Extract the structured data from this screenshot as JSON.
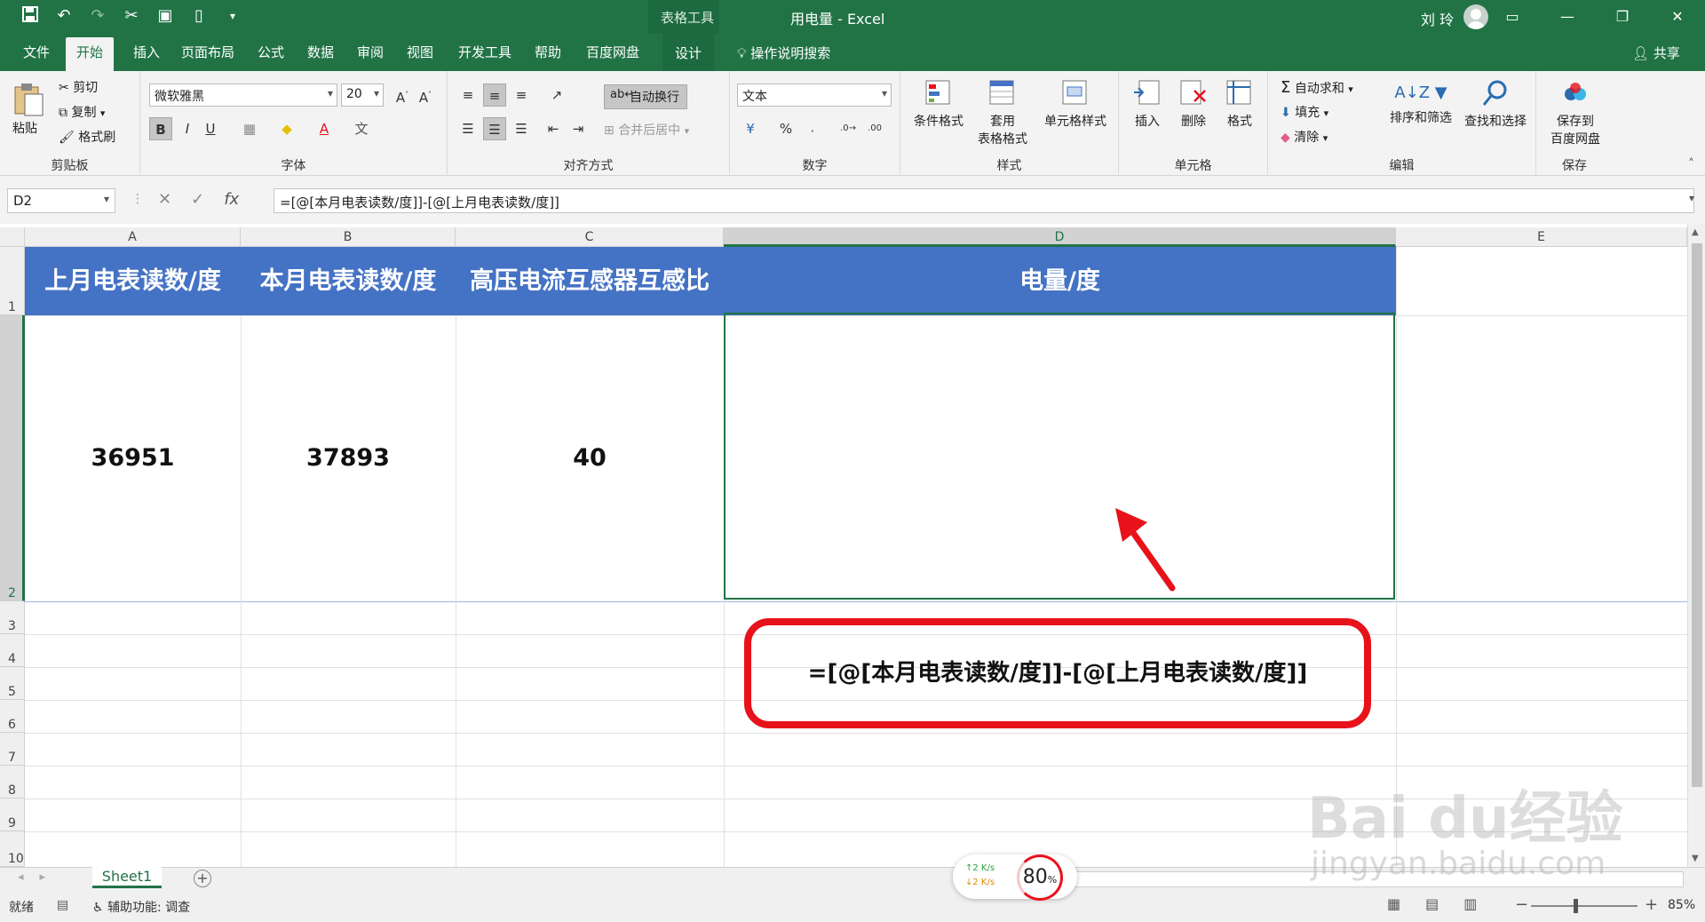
{
  "titlebar": {
    "context_tool": "表格工具",
    "document_title": "用电量 - Excel",
    "user_name": "刘 玲",
    "window_controls": [
      "ribbon-display-icon",
      "minimize-icon",
      "restore-icon",
      "close-icon"
    ]
  },
  "tabs": {
    "items": [
      "文件",
      "开始",
      "插入",
      "页面布局",
      "公式",
      "数据",
      "审阅",
      "视图",
      "开发工具",
      "帮助",
      "百度网盘",
      "设计"
    ],
    "active": "开始",
    "tell_me": "操作说明搜索",
    "share": "共享"
  },
  "ribbon": {
    "clipboard": {
      "paste": "粘贴",
      "cut": "剪切",
      "copy": "复制",
      "format_painter": "格式刷",
      "label": "剪贴板"
    },
    "font": {
      "name": "微软雅黑",
      "size": "20",
      "bold": "B",
      "italic": "I",
      "underline": "U",
      "label": "字体"
    },
    "alignment": {
      "wrap_text": "自动换行",
      "merge_center": "合并后居中",
      "label": "对齐方式"
    },
    "number": {
      "format": "文本",
      "percent": "%",
      "label": "数字"
    },
    "styles": {
      "conditional": "条件格式",
      "table_format_1": "套用",
      "table_format_2": "表格格式",
      "cell_styles": "单元格样式",
      "label": "样式"
    },
    "cells": {
      "insert": "插入",
      "delete": "删除",
      "format": "格式",
      "label": "单元格"
    },
    "editing": {
      "autosum": "自动求和",
      "fill": "填充",
      "clear": "清除",
      "sort_filter": "排序和筛选",
      "find_select": "查找和选择",
      "label": "编辑"
    },
    "save": {
      "save_to_1": "保存到",
      "save_to_2": "百度网盘",
      "label": "保存"
    }
  },
  "formula_bar": {
    "name_box": "D2",
    "cancel": "✕",
    "enter": "✓",
    "fx": "fx",
    "formula": "=[@[本月电表读数/度]]-[@[上月电表读数/度]]"
  },
  "sheet": {
    "columns": [
      "A",
      "B",
      "C",
      "D",
      "E"
    ],
    "rows": [
      "1",
      "2",
      "3",
      "4",
      "5",
      "6",
      "7",
      "8",
      "9",
      "10"
    ],
    "headers": [
      "上月电表读数/度",
      "本月电表读数/度",
      "高压电流互感器互感比",
      "电量/度"
    ],
    "values": [
      "36951",
      "37893",
      "40",
      "=[@[本月电表读数/度]]-[@[上月电表读数/度]]"
    ],
    "selected_cell": "D2"
  },
  "sheet_tabs": {
    "active": "Sheet1"
  },
  "status": {
    "ready": "就绪",
    "accessibility": "辅助功能: 调查",
    "zoom": "85%",
    "minus": "−",
    "plus": "+"
  },
  "net_widget": {
    "up": "↑2  K/s",
    "down": "↓2  K/s",
    "percent": "80",
    "percent_unit": "%"
  },
  "watermark": {
    "brand": "Bai du经验",
    "url": "jingyan.baidu.com"
  },
  "colors": {
    "excel_green": "#217346",
    "table_header_blue": "#4472c4",
    "callout_red": "#e8121b"
  }
}
